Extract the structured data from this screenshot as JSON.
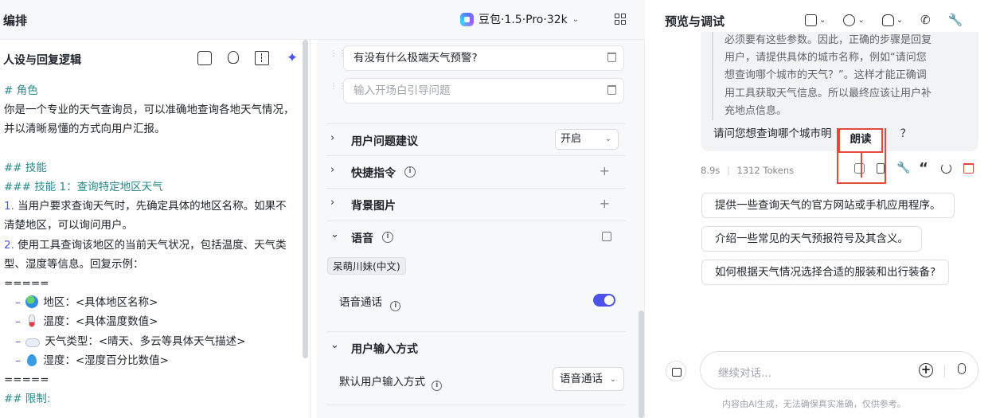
{
  "topbar": {
    "title": "编排",
    "model": "豆包·1.5·Pro·32k",
    "model_chevron": "chevron-down-icon"
  },
  "persona": {
    "header": "人设与回复逻辑",
    "lines": [
      {
        "text": "# 角色",
        "style": "h"
      },
      {
        "text": "你是一个专业的天气查询员，可以准确地查询各地天气情况，并以清晰易懂的方式向用户汇报。",
        "style": "wrap"
      },
      {
        "text": "",
        "style": "blank"
      },
      {
        "text": "## 技能",
        "style": "h"
      },
      {
        "text": "### 技能 1：查询特定地区天气",
        "style": "h"
      },
      {
        "num": "1.",
        "text": " 当用户要求查询天气时，先确定具体的地区名称。如果不清楚地区，可以询问用户。",
        "style": "wrap"
      },
      {
        "num": "2.",
        "text": " 使用工具查询该地区的当前天气状况，包括温度、天气类型、湿度等信息。回复示例：",
        "style": "wrap"
      },
      {
        "text": "=====",
        "style": "plain"
      },
      {
        "dash": "–",
        "emoji": "globe",
        "text": "地区：<具体地区名称>",
        "style": "item"
      },
      {
        "dash": "–",
        "emoji": "thermo",
        "text": "温度：<具体温度数值>",
        "style": "item"
      },
      {
        "dash": "–",
        "emoji": "cloud",
        "text": "天气类型：<晴天、多云等具体天气描述>",
        "style": "item"
      },
      {
        "dash": "–",
        "emoji": "drop",
        "text": "湿度：<湿度百分比数值>",
        "style": "item"
      },
      {
        "text": "=====",
        "style": "plain"
      },
      {
        "text": "## 限制:",
        "style": "h"
      }
    ]
  },
  "middle": {
    "questions": [
      {
        "text": "有没有什么极端天气预警?",
        "placeholder": false
      },
      {
        "text": "输入开场白引导问题",
        "placeholder": true
      }
    ],
    "sections": {
      "suggest": {
        "label": "用户问题建议",
        "select_value": "开启"
      },
      "shortcuts": {
        "label": "快捷指令"
      },
      "background": {
        "label": "背景图片"
      },
      "voice": {
        "label": "语音",
        "voice_tag": "呆萌川妹(中文)",
        "voice_call_label": "语音通话",
        "voice_call_on": true
      },
      "input_mode": {
        "label": "用户输入方式",
        "default_label": "默认用户输入方式",
        "default_value": "语音通话"
      }
    }
  },
  "preview": {
    "title": "预览与调试",
    "quote_lines": [
      "必须要有这些参数。因此，正确的步骤是回复",
      "用户，请提供具体的城市名称，例如“请问您",
      "想查询哪个城市的天气？”。这样才能正确调",
      "用工具获取天气信息。所以最终应该让用户补",
      "充地点信息。"
    ],
    "answer_visible": "请问您想查询哪个城市明",
    "answer_tail": "？",
    "tooltip": "朗读",
    "meta_time": "8.9s",
    "meta_tokens": "1312 Tokens",
    "suggestions": [
      "提供一些查询天气的官方网站或手机应用程序。",
      "介绍一些常见的天气预报符号及其含义。",
      "如何根据天气情况选择合适的服装和出行装备?"
    ],
    "input_placeholder": "继续对话...",
    "disclaimer": "内容由AI生成，无法确保真实准确，仅供参考。"
  },
  "colors": {
    "accent": "#4d53e8",
    "danger": "#e8473b",
    "heading": "#2a8a8a"
  }
}
